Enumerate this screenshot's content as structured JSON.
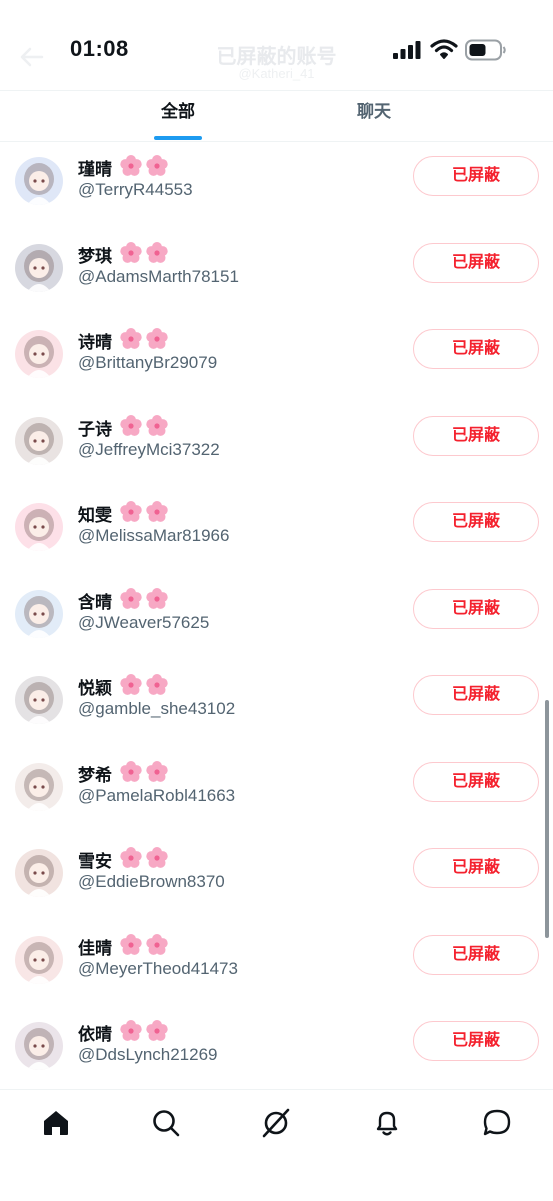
{
  "status_bar": {
    "time": "01:08",
    "background_title": "已屏蔽的账号",
    "background_subtitle": "@Katheri_41"
  },
  "tabs": [
    {
      "label": "全部",
      "active": true
    },
    {
      "label": "聊天",
      "active": false
    }
  ],
  "blocked_label": "已屏蔽",
  "accounts": [
    {
      "name": "瑾晴",
      "handle": "@TerryR44553",
      "avatar_color": "#dfe7f7"
    },
    {
      "name": "梦琪",
      "handle": "@AdamsMarth78151",
      "avatar_color": "#d7d8e0"
    },
    {
      "name": "诗晴",
      "handle": "@BrittanyBr29079",
      "avatar_color": "#fbe2e6"
    },
    {
      "name": "子诗",
      "handle": "@JeffreyMci37322",
      "avatar_color": "#e9e3e2"
    },
    {
      "name": "知雯",
      "handle": "@MelissaMar81966",
      "avatar_color": "#fde0e8"
    },
    {
      "name": "含晴",
      "handle": "@JWeaver57625",
      "avatar_color": "#e2ecf8"
    },
    {
      "name": "悦颖",
      "handle": "@gamble_she43102",
      "avatar_color": "#e4e2e4"
    },
    {
      "name": "梦希",
      "handle": "@PamelaRobl41663",
      "avatar_color": "#f3ecea"
    },
    {
      "name": "雪安",
      "handle": "@EddieBrown8370",
      "avatar_color": "#f1e3e0"
    },
    {
      "name": "佳晴",
      "handle": "@MeyerTheod41473",
      "avatar_color": "#f8e6e6"
    },
    {
      "name": "依晴",
      "handle": "@DdsLynch21269",
      "avatar_color": "#ebe4ea"
    }
  ],
  "colors": {
    "accent": "#1d9bf0",
    "blocked_text": "#f4212e",
    "blocked_border": "#fdc9ce",
    "handle_text": "#536471"
  },
  "bottom_nav": [
    "home-icon",
    "search-icon",
    "grok-icon",
    "bell-icon",
    "messages-icon"
  ]
}
